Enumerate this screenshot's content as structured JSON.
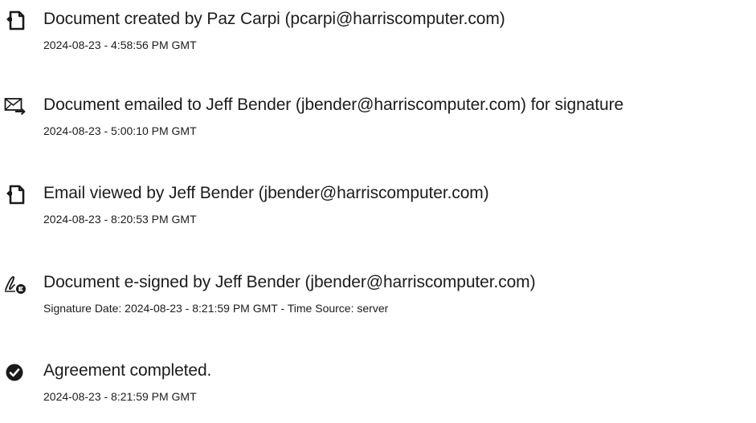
{
  "events": [
    {
      "icon": "document-created-icon",
      "title": "Document created by Paz Carpi (pcarpi@harriscomputer.com)",
      "time": "2024-08-23 - 4:58:56 PM GMT"
    },
    {
      "icon": "email-sent-icon",
      "title": "Document emailed to Jeff Bender (jbender@harriscomputer.com) for signature",
      "time": "2024-08-23 - 5:00:10 PM GMT"
    },
    {
      "icon": "document-viewed-icon",
      "title": "Email viewed by Jeff Bender (jbender@harriscomputer.com)",
      "time": "2024-08-23 - 8:20:53 PM GMT"
    },
    {
      "icon": "e-sign-icon",
      "title": "Document e-signed by Jeff Bender (jbender@harriscomputer.com)",
      "time": "Signature Date: 2024-08-23 - 8:21:59 PM GMT - Time Source: server"
    },
    {
      "icon": "check-circle-icon",
      "title": "Agreement completed.",
      "time": "2024-08-23 - 8:21:59 PM GMT"
    }
  ],
  "colors": {
    "icon": "#1a1a1a",
    "text": "#1c1c1c",
    "background": "#ffffff"
  }
}
